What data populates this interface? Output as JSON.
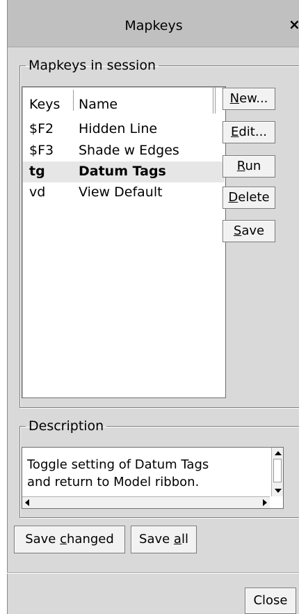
{
  "window": {
    "title": "Mapkeys",
    "close_glyph": "×"
  },
  "session_group": {
    "legend": "Mapkeys in session",
    "columns": {
      "keys": "Keys",
      "name": "Name"
    },
    "rows": [
      {
        "keys": "$F2",
        "name": "Hidden Line",
        "selected": false
      },
      {
        "keys": "$F3",
        "name": "Shade w Edges",
        "selected": false
      },
      {
        "keys": "tg",
        "name": "Datum Tags",
        "selected": true
      },
      {
        "keys": "vd",
        "name": "View Default",
        "selected": false
      }
    ]
  },
  "buttons": {
    "new": {
      "mnemonic": "N",
      "rest": "ew..."
    },
    "edit": {
      "mnemonic": "E",
      "rest": "dit..."
    },
    "run": {
      "mnemonic": "R",
      "rest": "un"
    },
    "delete": {
      "mnemonic": "D",
      "rest": "elete"
    },
    "save": {
      "mnemonic": "S",
      "rest": "ave"
    },
    "save_changed": {
      "pre": "Save ",
      "mnemonic": "c",
      "rest": "hanged"
    },
    "save_all": {
      "pre": "Save ",
      "mnemonic": "a",
      "rest": "ll"
    },
    "close": "Close"
  },
  "description_group": {
    "legend": "Description",
    "lines": [
      "Toggle setting of Datum Tags",
      "and return to Model ribbon."
    ]
  },
  "icons": {
    "scroll_up": "scroll-up-arrow-icon",
    "scroll_down": "scroll-down-arrow-icon",
    "scroll_left": "scroll-left-arrow-icon",
    "scroll_right": "scroll-right-arrow-icon"
  }
}
